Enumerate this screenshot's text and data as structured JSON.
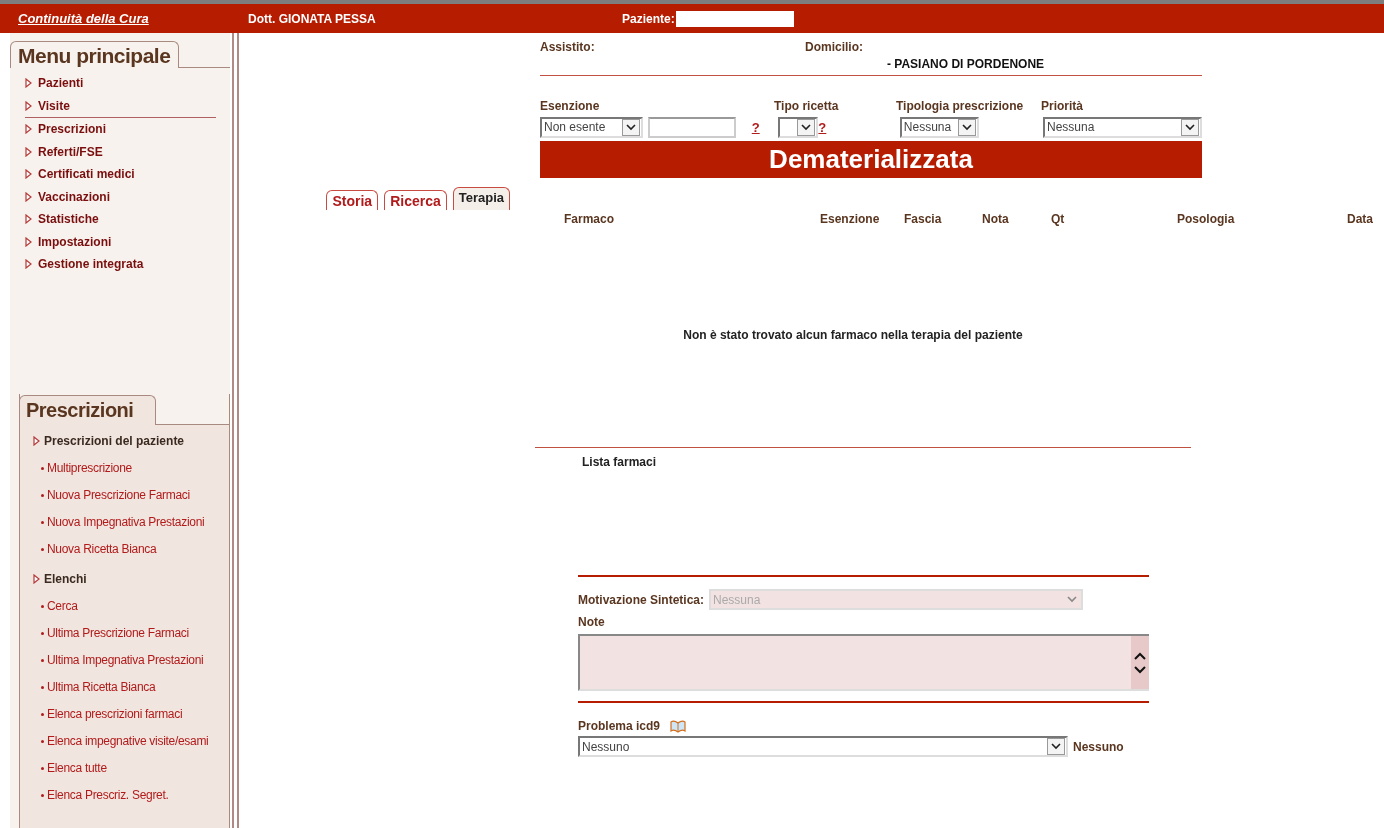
{
  "header": {
    "logo": "Continuità della Cura",
    "doctor": "Dott. GIONATA PESSA",
    "patient_label": "Paziente:"
  },
  "main_menu": {
    "title": "Menu principale",
    "groups": [
      {
        "items": [
          "Pazienti",
          "Visite"
        ]
      },
      {
        "items": [
          "Prescrizioni",
          "Referti/FSE",
          "Certificati medici",
          "Vaccinazioni",
          "Statistiche",
          "Impostazioni",
          "Gestione integrata"
        ]
      }
    ]
  },
  "prescriptions_panel": {
    "title": "Prescrizioni",
    "sections": [
      {
        "label": "Prescrizioni del paziente",
        "items": [
          "Multiprescrizione",
          "Nuova Prescrizione Farmaci",
          "Nuova Impegnativa Prestazioni",
          "Nuova Ricetta Bianca"
        ]
      },
      {
        "label": "Elenchi",
        "items": [
          "Cerca",
          "Ultima Prescrizione Farmaci",
          "Ultima Impegnativa Prestazioni",
          "Ultima Ricetta Bianca",
          "Elenca prescrizioni farmaci",
          "Elenca impegnative visite/esami",
          "Elenca tutte",
          "Elenca Prescriz. Segret."
        ]
      }
    ]
  },
  "tabs": [
    {
      "label": "Storia",
      "selected": false
    },
    {
      "label": "Ricerca",
      "selected": false
    },
    {
      "label": "Terapia",
      "selected": true
    }
  ],
  "patient": {
    "assistito_label": "Assistito:",
    "domicilio_label": "Domicilio:",
    "domicilio_value": "- PASIANO DI PORDENONE"
  },
  "form": {
    "esenzione": {
      "label": "Esenzione",
      "value": "Non esente",
      "help": "?"
    },
    "tipo_ricetta": {
      "label": "Tipo ricetta",
      "help": "?"
    },
    "tipologia": {
      "label": "Tipologia prescrizione",
      "value": "Nessuna"
    },
    "priorita": {
      "label": "Priorità",
      "value": "Nessuna"
    }
  },
  "banner": "Dematerializzata",
  "table": {
    "columns": [
      "Farmaco",
      "Esenzione",
      "Fascia",
      "Nota",
      "Qt",
      "Posologia",
      "Data"
    ],
    "empty_message": "Non è stato trovato alcun farmaco nella terapia del paziente"
  },
  "lista_farmaci": "Lista farmaci",
  "motivazione": {
    "label": "Motivazione Sintetica:",
    "value": "Nessuna",
    "disabled": true
  },
  "note": {
    "label": "Note"
  },
  "problema": {
    "label": "Problema icd9",
    "value": "Nessuno",
    "selected_text": "Nessuno"
  }
}
